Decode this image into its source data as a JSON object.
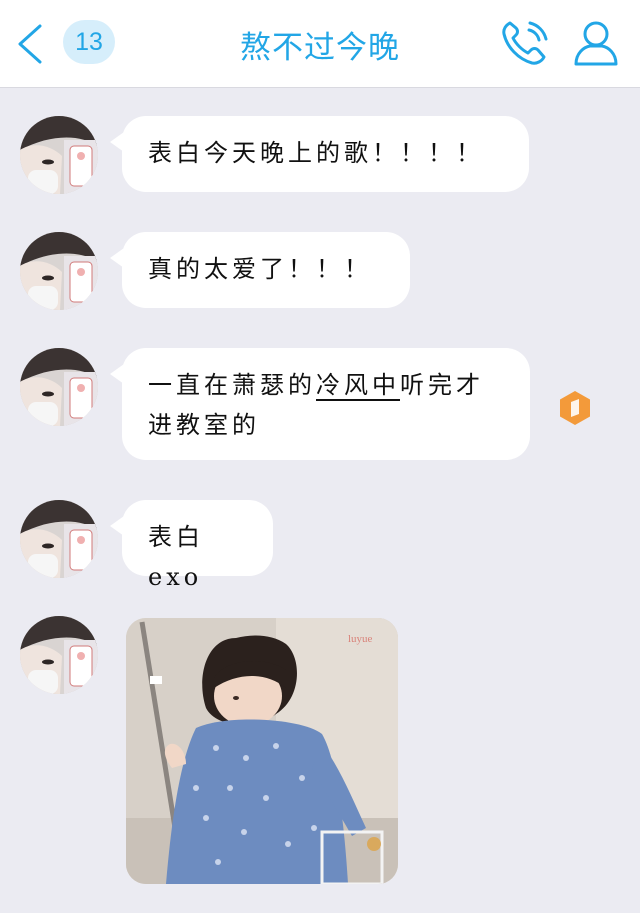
{
  "header": {
    "unread_count": "13",
    "title": "熬不过今晚",
    "accent_color": "#22a6e6",
    "icons": [
      "back-chevron-icon",
      "phone-icon",
      "profile-icon"
    ]
  },
  "messages": [
    {
      "sender": "other",
      "text": "表白今天晚上的歌！！！！"
    },
    {
      "sender": "other",
      "text": "真的太爱了！！！"
    },
    {
      "sender": "other",
      "text_before": "一直在萧瑟的",
      "text_link": "冷风中",
      "text_after": "听完才进教室的",
      "status_icon": "orange-hexagon-icon"
    },
    {
      "sender": "other",
      "text": "表白exo"
    },
    {
      "sender": "other",
      "type": "image",
      "watermark": "luyue"
    }
  ]
}
